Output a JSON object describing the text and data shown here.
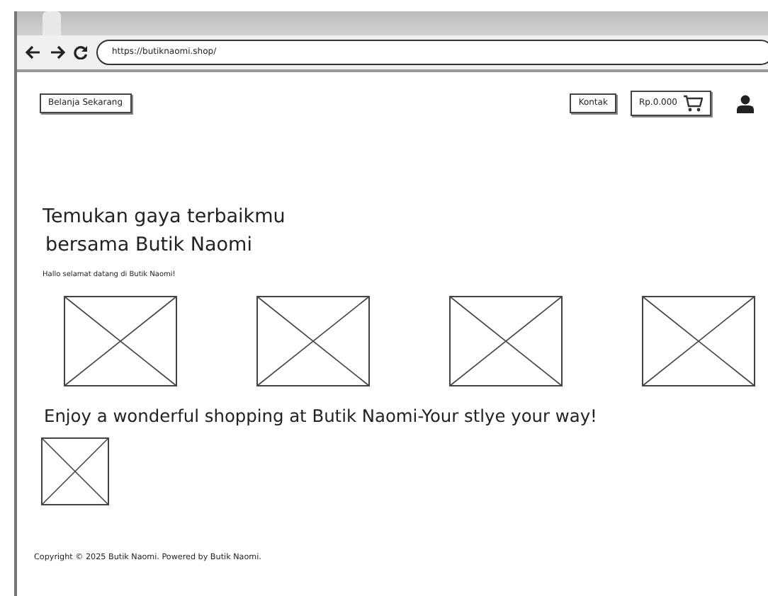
{
  "browser": {
    "url": "https://butiknaomi.shop/"
  },
  "header": {
    "shop_button": "Belanja Sekarang",
    "contact_button": "Kontak",
    "cart_total": "Rp.0.000"
  },
  "hero": {
    "title_lines": [
      "Temukan gaya terbaikmu",
      "bersama Butik Naomi"
    ],
    "greeting": "Hallo selamat datang di Butik Naomi!"
  },
  "gallery": [
    {
      "kind": "image_placeholder"
    },
    {
      "kind": "image_placeholder"
    },
    {
      "kind": "image_placeholder"
    },
    {
      "kind": "image_placeholder"
    }
  ],
  "tagline": "Enjoy a wonderful shopping at Butik Naomi-Your stlye your way!",
  "feature": [
    {
      "kind": "image_placeholder"
    }
  ],
  "footer": "Copyright © 2025 Butik Naomi. Powered by Butik Naomi."
}
